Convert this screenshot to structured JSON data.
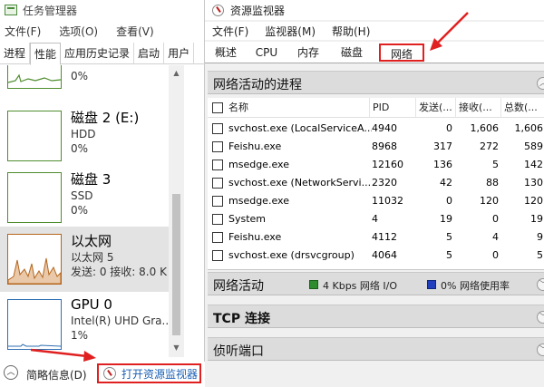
{
  "task_manager": {
    "title": "任务管理器",
    "menu": [
      "文件(F)",
      "选项(O)",
      "查看(V)"
    ],
    "tabs": [
      {
        "label": "进程"
      },
      {
        "label": "性能"
      },
      {
        "label": "应用历史记录"
      },
      {
        "label": "启动"
      },
      {
        "label": "用户"
      }
    ],
    "active_tab": "性能",
    "perf_items": [
      {
        "name": "",
        "sub": "",
        "value": "0%"
      },
      {
        "name": "磁盘 2 (E:)",
        "sub": "HDD",
        "value": "0%"
      },
      {
        "name": "磁盘 3",
        "sub": "SSD",
        "value": "0%"
      },
      {
        "name": "以太网",
        "sub": "以太网 5",
        "value": "发送: 0 接收: 8.0 K"
      },
      {
        "name": "GPU 0",
        "sub": "Intel(R) UHD Gra...",
        "value": "1%"
      }
    ],
    "footer": {
      "fewer_details": "简略信息(D)",
      "open_resource_monitor": "打开资源监视器"
    }
  },
  "resource_monitor": {
    "title": "资源监视器",
    "menu": [
      "文件(F)",
      "监视器(M)",
      "帮助(H)"
    ],
    "tabs": [
      "概述",
      "CPU",
      "内存",
      "磁盘",
      "网络"
    ],
    "active_tab": "网络",
    "processes_section": {
      "title": "网络活动的进程",
      "columns": [
        "名称",
        "PID",
        "发送(...",
        "接收(...",
        "总数(..."
      ],
      "rows": [
        {
          "name": "svchost.exe (LocalServiceA...",
          "pid": "4940",
          "send": "0",
          "recv": "1,606",
          "total": "1,606"
        },
        {
          "name": "Feishu.exe",
          "pid": "8968",
          "send": "317",
          "recv": "272",
          "total": "589"
        },
        {
          "name": "msedge.exe",
          "pid": "12160",
          "send": "136",
          "recv": "5",
          "total": "142"
        },
        {
          "name": "svchost.exe (NetworkServi...",
          "pid": "2320",
          "send": "42",
          "recv": "88",
          "total": "130"
        },
        {
          "name": "msedge.exe",
          "pid": "11032",
          "send": "0",
          "recv": "120",
          "total": "120"
        },
        {
          "name": "System",
          "pid": "4",
          "send": "19",
          "recv": "0",
          "total": "19"
        },
        {
          "name": "Feishu.exe",
          "pid": "4112",
          "send": "5",
          "recv": "4",
          "total": "9"
        },
        {
          "name": "svchost.exe (drsvcgroup)",
          "pid": "4064",
          "send": "5",
          "recv": "0",
          "total": "5"
        }
      ]
    },
    "network_activity": {
      "title": "网络活动",
      "io_label": "4 Kbps 网络 I/O",
      "usage_label": "0% 网络使用率"
    },
    "tcp_title": "TCP 连接",
    "listening_title": "侦听端口"
  },
  "colors": {
    "annotation_red": "#e02020",
    "graph_green": "#4f8d2e",
    "ethernet_orange": "#b5651d",
    "io_green": "#2e8b2e",
    "usage_blue": "#1f3fbf"
  }
}
